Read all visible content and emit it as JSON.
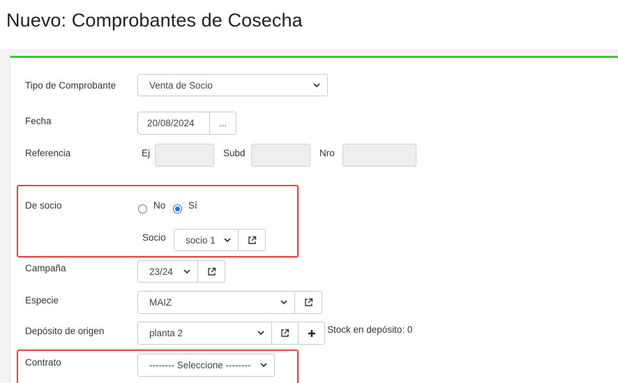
{
  "page": {
    "title": "Nuevo: Comprobantes de Cosecha"
  },
  "colors": {
    "accent_bar": "#2ecc2e",
    "highlight_box": "#e04848",
    "radio_checked": "#1a73e8"
  },
  "form": {
    "tipo_comprobante": {
      "label": "Tipo de Comprobante",
      "value": "Venta de Socio"
    },
    "fecha": {
      "label": "Fecha",
      "value": "20/08/2024",
      "button_label": "..."
    },
    "referencia": {
      "label": "Referencia",
      "ej_label": "Ej",
      "ej_value": "",
      "subd_label": "Subd",
      "subd_value": "",
      "nro_label": "Nro",
      "nro_value": ""
    },
    "de_socio": {
      "label": "De socio",
      "option_no": "No",
      "option_si": "Sí",
      "selected": "Sí"
    },
    "socio": {
      "label": "Socio",
      "value": "socio 1"
    },
    "campana": {
      "label": "Campaña",
      "value": "23/24"
    },
    "especie": {
      "label": "Especie",
      "value": "MAIZ"
    },
    "deposito_origen": {
      "label": "Depósito de origen",
      "value": "planta 2",
      "stock_text": "Stock en depósito: 0"
    },
    "contrato": {
      "label": "Contrato",
      "value": "-------- Seleccione --------"
    }
  }
}
